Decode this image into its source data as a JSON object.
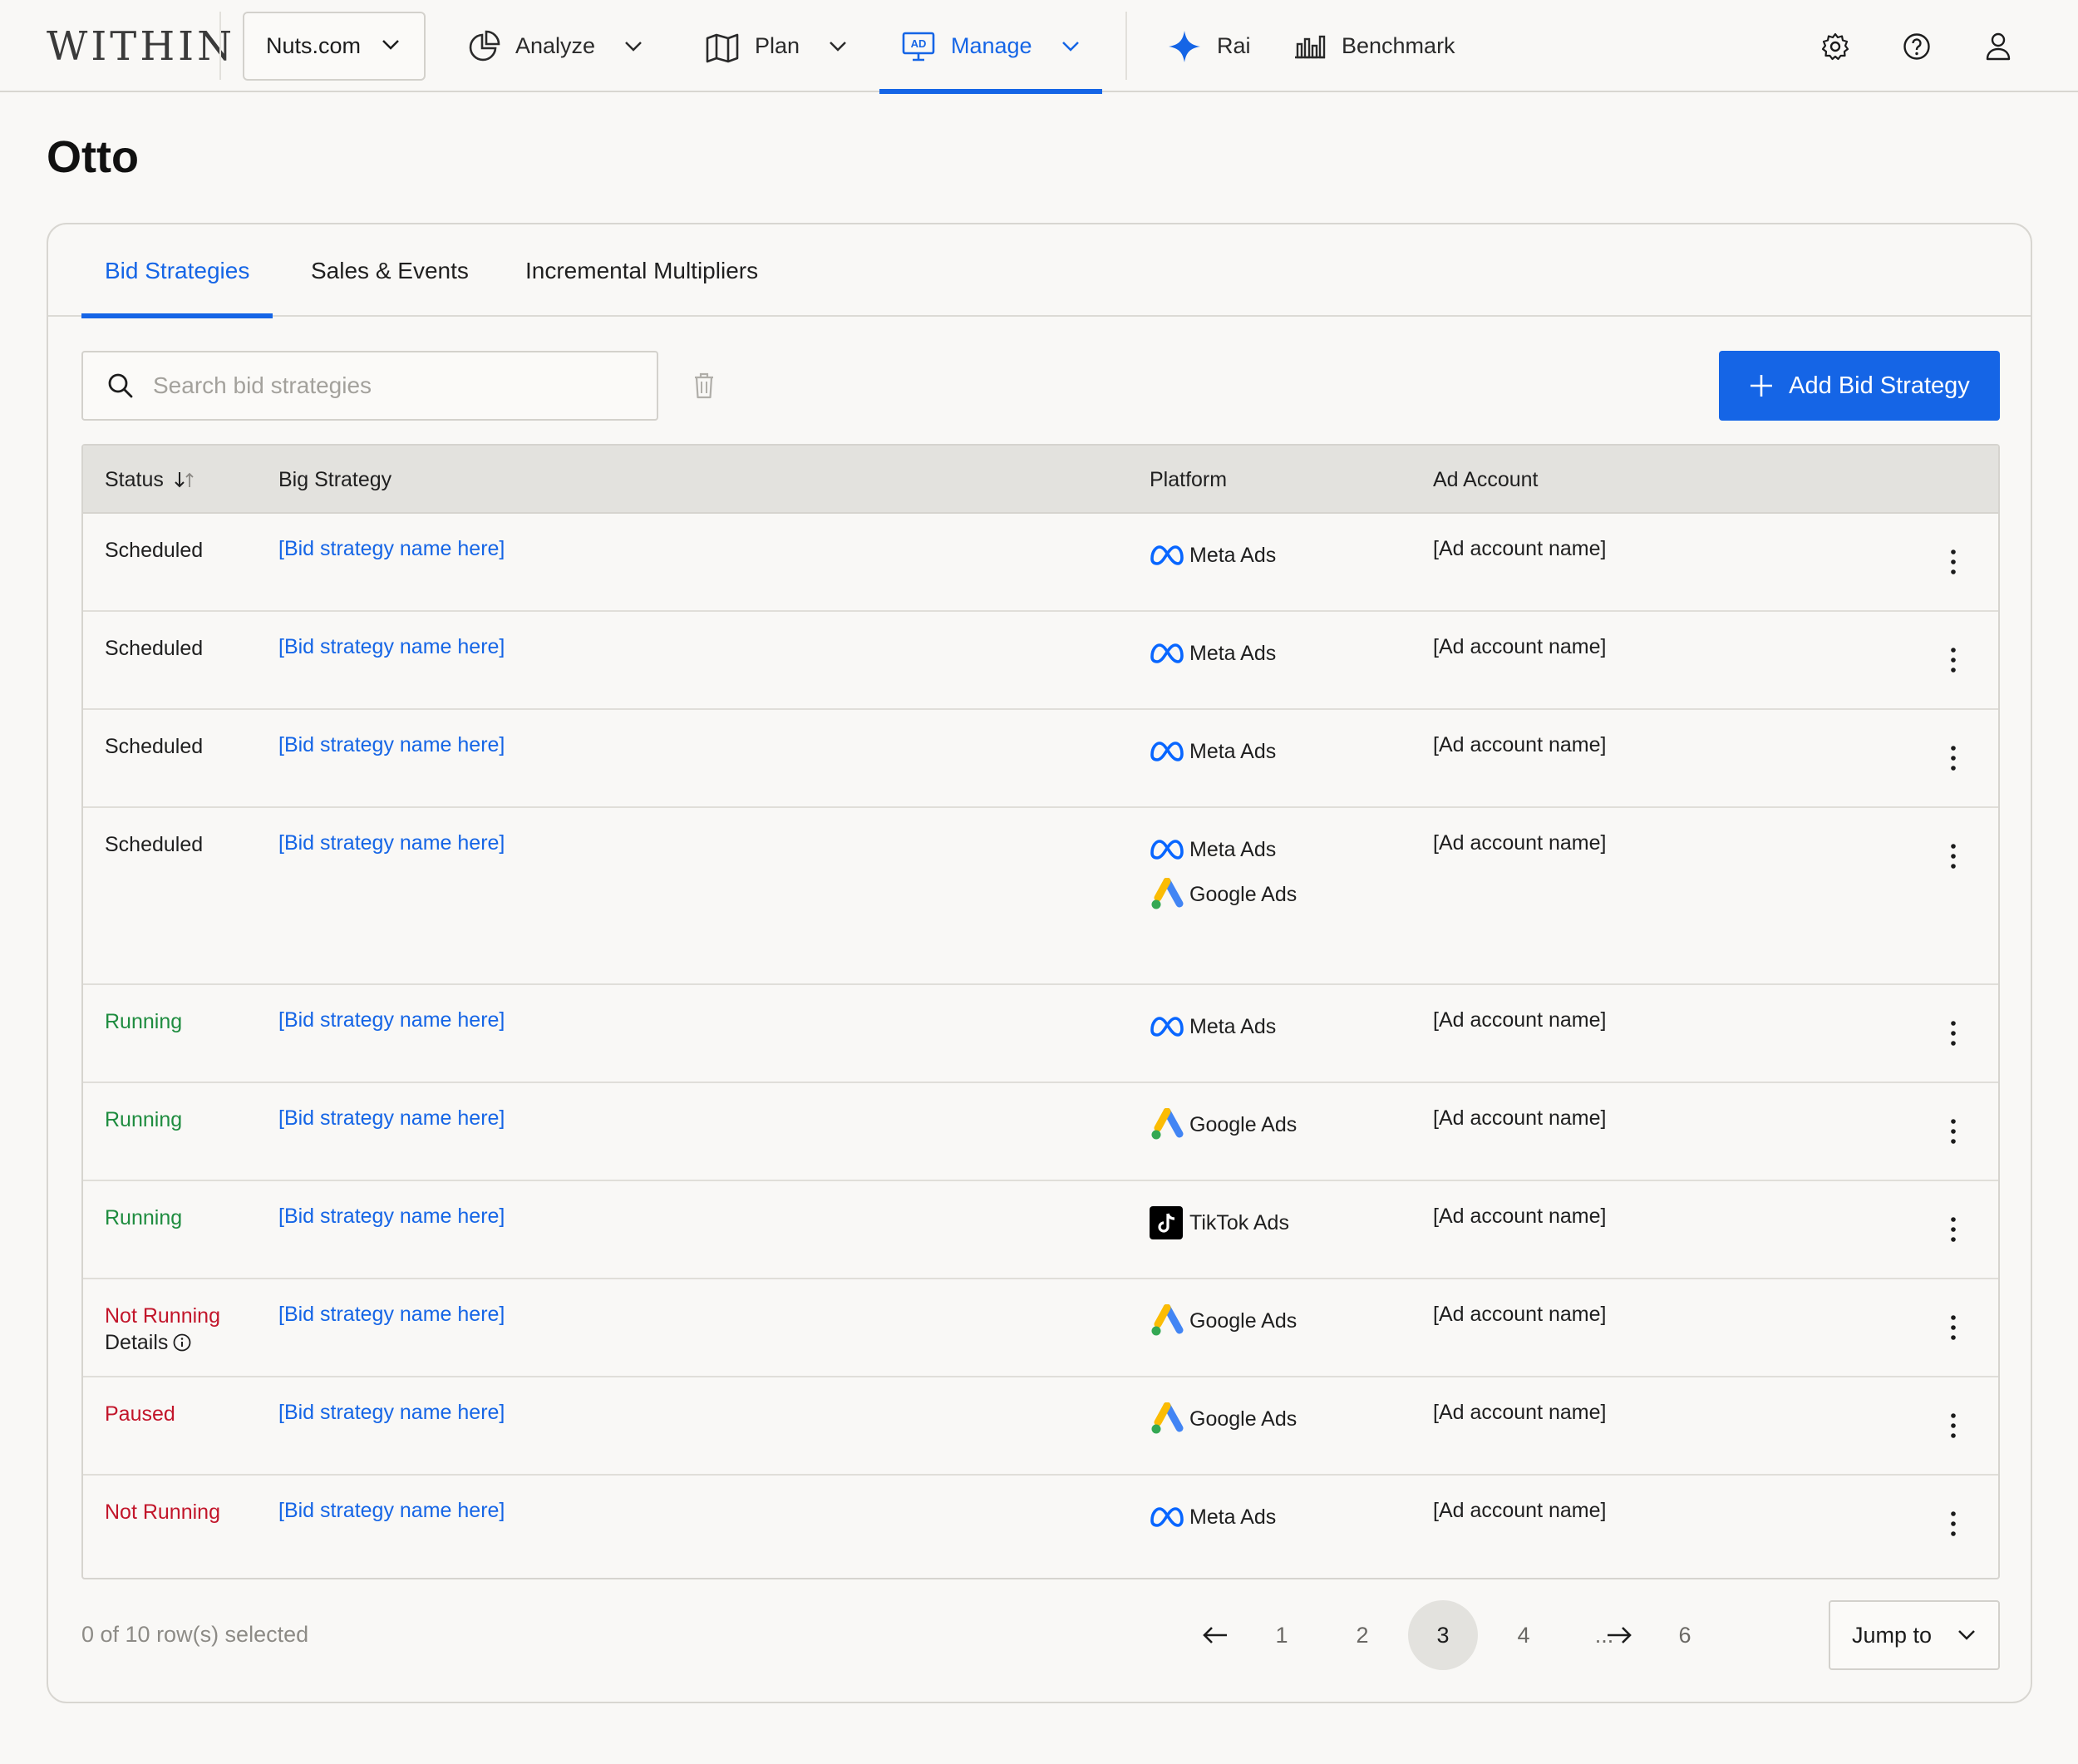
{
  "nav": {
    "logo": "WITHIN",
    "org": "Nuts.com",
    "items": [
      {
        "label": "Analyze",
        "icon": "pie-chart-icon"
      },
      {
        "label": "Plan",
        "icon": "map-icon"
      },
      {
        "label": "Manage",
        "icon": "ad-board-icon",
        "active": true
      }
    ],
    "rai": "Rai",
    "benchmark": "Benchmark"
  },
  "page": {
    "title": "Otto",
    "tabs": [
      {
        "label": "Bid Strategies",
        "active": true
      },
      {
        "label": "Sales & Events"
      },
      {
        "label": "Incremental Multipliers"
      }
    ],
    "search_placeholder": "Search bid strategies",
    "add_button": "Add Bid Strategy"
  },
  "table": {
    "columns": [
      "Status",
      "Big Strategy",
      "Platform",
      "Ad Account"
    ],
    "rows": [
      {
        "status": "Scheduled",
        "status_kind": "scheduled",
        "name": "[Bid strategy name here]",
        "platforms": [
          "Meta Ads"
        ],
        "account": "[Ad account name]"
      },
      {
        "status": "Scheduled",
        "status_kind": "scheduled",
        "name": "[Bid strategy name here]",
        "platforms": [
          "Meta Ads"
        ],
        "account": "[Ad account name]"
      },
      {
        "status": "Scheduled",
        "status_kind": "scheduled",
        "name": "[Bid strategy name here]",
        "platforms": [
          "Meta Ads"
        ],
        "account": "[Ad account name]"
      },
      {
        "status": "Scheduled",
        "status_kind": "scheduled",
        "name": "[Bid strategy name here]",
        "platforms": [
          "Meta Ads",
          "Google Ads"
        ],
        "account": "[Ad account name]"
      },
      {
        "status": "Running",
        "status_kind": "running",
        "name": "[Bid strategy name here]",
        "platforms": [
          "Meta Ads"
        ],
        "account": "[Ad account name]"
      },
      {
        "status": "Running",
        "status_kind": "running",
        "name": "[Bid strategy name here]",
        "platforms": [
          "Google Ads"
        ],
        "account": "[Ad account name]"
      },
      {
        "status": "Running",
        "status_kind": "running",
        "name": "[Bid strategy name here]",
        "platforms": [
          "TikTok Ads"
        ],
        "account": "[Ad account name]"
      },
      {
        "status": "Not Running",
        "status_kind": "notrunning",
        "details": "Details",
        "name": "[Bid strategy name here]",
        "platforms": [
          "Google Ads"
        ],
        "account": "[Ad account name]"
      },
      {
        "status": "Paused",
        "status_kind": "paused",
        "name": "[Bid strategy name here]",
        "platforms": [
          "Google Ads"
        ],
        "account": "[Ad account name]"
      },
      {
        "status": "Not Running",
        "status_kind": "notrunning",
        "name": "[Bid strategy name here]",
        "platforms": [
          "Meta Ads"
        ],
        "account": "[Ad account name]"
      }
    ]
  },
  "footer": {
    "selected": "0 of 10 row(s) selected",
    "pages": [
      "1",
      "2",
      "3",
      "4",
      "...",
      "6"
    ],
    "current_page": "3",
    "jump": "Jump to"
  },
  "colors": {
    "accent": "#1565e6",
    "running": "#1e8c3f",
    "not_running": "#c2152a"
  }
}
